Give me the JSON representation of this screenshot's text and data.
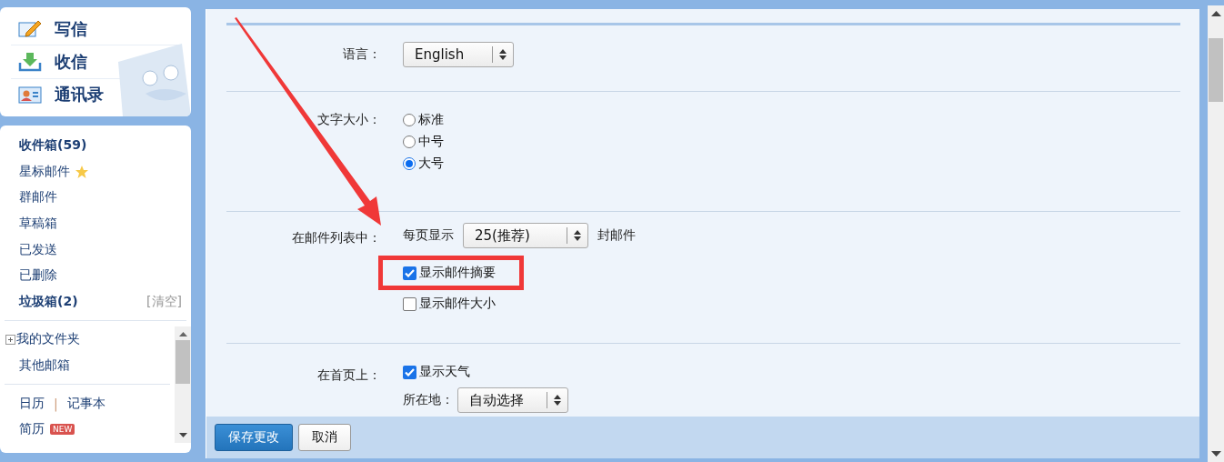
{
  "quick_actions": [
    {
      "label": "写信",
      "kind": "compose"
    },
    {
      "label": "收信",
      "kind": "inbox"
    },
    {
      "label": "通讯录",
      "kind": "contacts"
    }
  ],
  "folders": [
    {
      "label": "收件箱(59)",
      "emphasized": true
    },
    {
      "label": "星标邮件",
      "emphasized": false,
      "starred": true
    },
    {
      "label": "群邮件",
      "emphasized": false
    },
    {
      "label": "草稿箱",
      "emphasized": false
    },
    {
      "label": "已发送",
      "emphasized": false
    },
    {
      "label": "已删除",
      "emphasized": false
    },
    {
      "label": "垃圾箱(2)",
      "emphasized": true,
      "action": "[清空]"
    }
  ],
  "my_folders": [
    {
      "label": "我的文件夹",
      "expandable": true
    },
    {
      "label": "其他邮箱",
      "expandable": false
    }
  ],
  "tools": {
    "links": [
      "日历",
      "记事本"
    ],
    "separator": "|",
    "resume": {
      "label": "简历",
      "badge": "NEW"
    }
  },
  "settings": {
    "rows": [
      {
        "kind": "select",
        "label": "语言：",
        "value": "English"
      },
      {
        "kind": "radios",
        "label": "文字大小：",
        "options": [
          {
            "label": "标准",
            "selected": false
          },
          {
            "label": "中号",
            "selected": false
          },
          {
            "label": "大号",
            "selected": true
          }
        ]
      },
      {
        "kind": "mail_list",
        "label": "在邮件列表中：",
        "prefix": "每页显示",
        "value": "25(推荐)",
        "suffix": "封邮件",
        "options": [
          {
            "label": "显示邮件摘要",
            "checked": true,
            "highlighted": true
          },
          {
            "label": "显示邮件大小",
            "checked": false,
            "highlighted": false
          }
        ]
      },
      {
        "kind": "home",
        "label": "在首页上：",
        "options": [
          {
            "label": "显示天气",
            "checked": true
          }
        ],
        "location_label": "所在地：",
        "value": "自动选择"
      }
    ]
  },
  "buttons": [
    {
      "label": "保存更改",
      "primary": true
    },
    {
      "label": "取消",
      "primary": false
    }
  ]
}
